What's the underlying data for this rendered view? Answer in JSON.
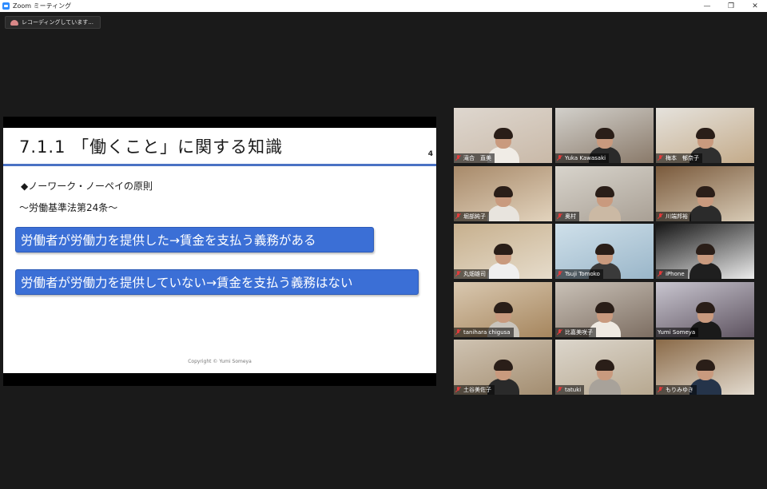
{
  "window": {
    "title": "Zoom ミーティング",
    "controls": {
      "minimize": "—",
      "restore": "❐",
      "close": "✕"
    }
  },
  "recording": {
    "label": "レコーディングしています..."
  },
  "slide": {
    "title": "7.1.1 「働くこと」に関する知識",
    "page_number": "4",
    "bullet": "◆ノーワーク・ノーペイの原則",
    "subheading": "〜労働基準法第24条〜",
    "box1": "労働者が労働力を提供した→賃金を支払う義務がある",
    "box2": "労働者が労働力を提供していない→賃金を支払う義務はない",
    "copyright": "Copyright © Yumi Someya",
    "accent_color": "#3b6fd6"
  },
  "participants": [
    {
      "name": "滝合　直美",
      "muted": true
    },
    {
      "name": "Yuka Kawasaki",
      "muted": true
    },
    {
      "name": "梅本　郁奈子",
      "muted": true
    },
    {
      "name": "堀部純子",
      "muted": true
    },
    {
      "name": "奥村",
      "muted": true
    },
    {
      "name": "川端邦裕",
      "muted": true
    },
    {
      "name": "丸畑雄司",
      "muted": true
    },
    {
      "name": "Tsuji Tomoko",
      "muted": true
    },
    {
      "name": "iPhone",
      "muted": true
    },
    {
      "name": "tanihara chigusa",
      "muted": true
    },
    {
      "name": "比嘉美咲子",
      "muted": true
    },
    {
      "name": "Yumi Someya",
      "muted": false,
      "active_speaker": true
    },
    {
      "name": "土谷美佐子",
      "muted": true
    },
    {
      "name": "tatuki",
      "muted": true
    },
    {
      "name": "もりみゆき",
      "muted": true
    }
  ]
}
